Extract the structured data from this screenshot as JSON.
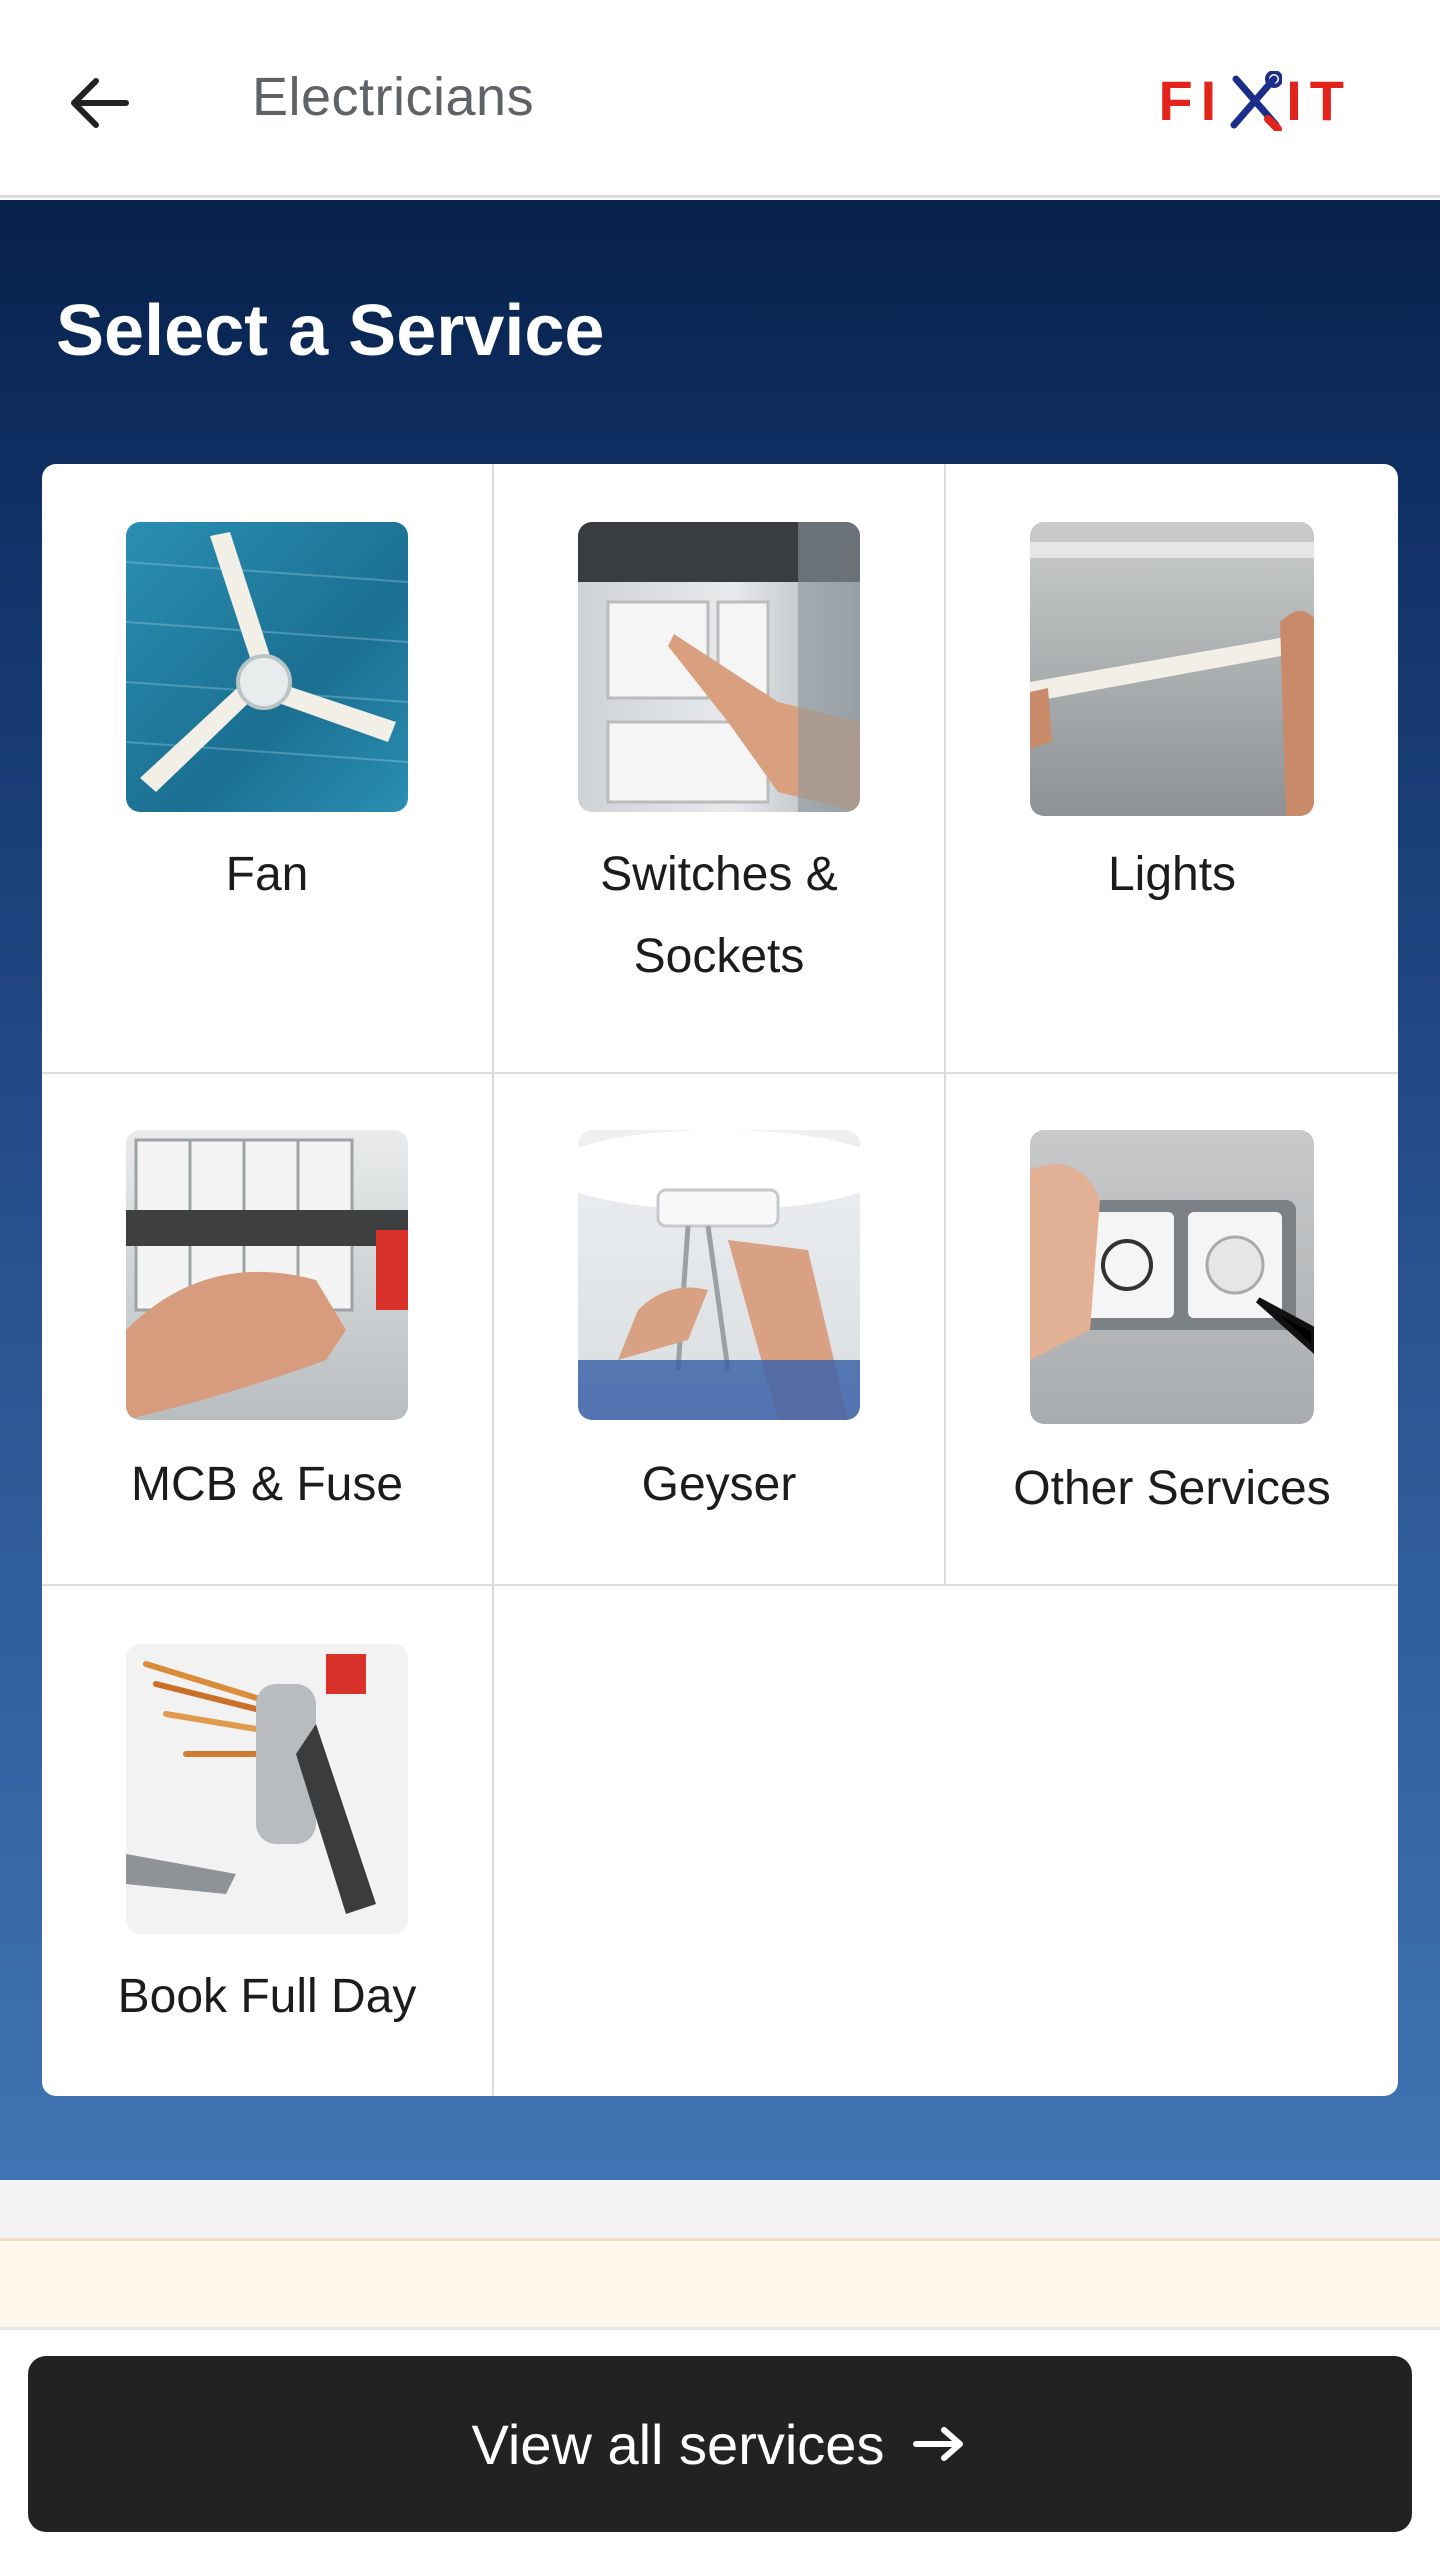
{
  "header": {
    "title": "Electricians",
    "logo_text": "FIXIT",
    "back_icon": "arrow-left-icon"
  },
  "hero": {
    "title": "Select a Service"
  },
  "services": [
    {
      "label": "Fan"
    },
    {
      "label": "Switches & Sockets"
    },
    {
      "label": "Lights"
    },
    {
      "label": "MCB & Fuse"
    },
    {
      "label": "Geyser"
    },
    {
      "label": "Other Services"
    },
    {
      "label": "Book Full Day"
    }
  ],
  "cta": {
    "label": "View all services",
    "icon": "arrow-right-icon"
  },
  "colors": {
    "brand_red": "#e3241b",
    "hero_top": "#06214a",
    "hero_bottom": "#3f75b4",
    "cta_bg": "#222222"
  }
}
